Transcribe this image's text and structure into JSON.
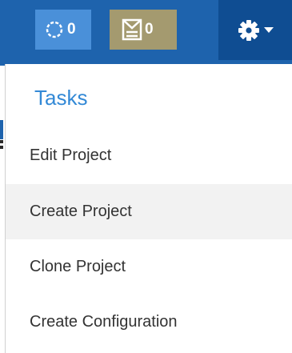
{
  "topbar": {
    "activity_badge": {
      "icon": "circle-dots-icon",
      "count": "0",
      "color": "#4a90d9"
    },
    "tasks_badge": {
      "icon": "inbox-icon",
      "count": "0",
      "color": "#a49a6f"
    },
    "settings_button": {
      "icon": "gear-icon",
      "caret": "caret-down-icon",
      "color": "#0f4d92"
    },
    "background": "#1e63ad"
  },
  "menu": {
    "header": "Tasks",
    "header_color": "#3389d6",
    "items": [
      {
        "label": "Edit Project",
        "highlighted": false
      },
      {
        "label": "Create Project",
        "highlighted": true
      },
      {
        "label": "Clone Project",
        "highlighted": false
      },
      {
        "label": "Create Configuration",
        "highlighted": false
      }
    ]
  }
}
